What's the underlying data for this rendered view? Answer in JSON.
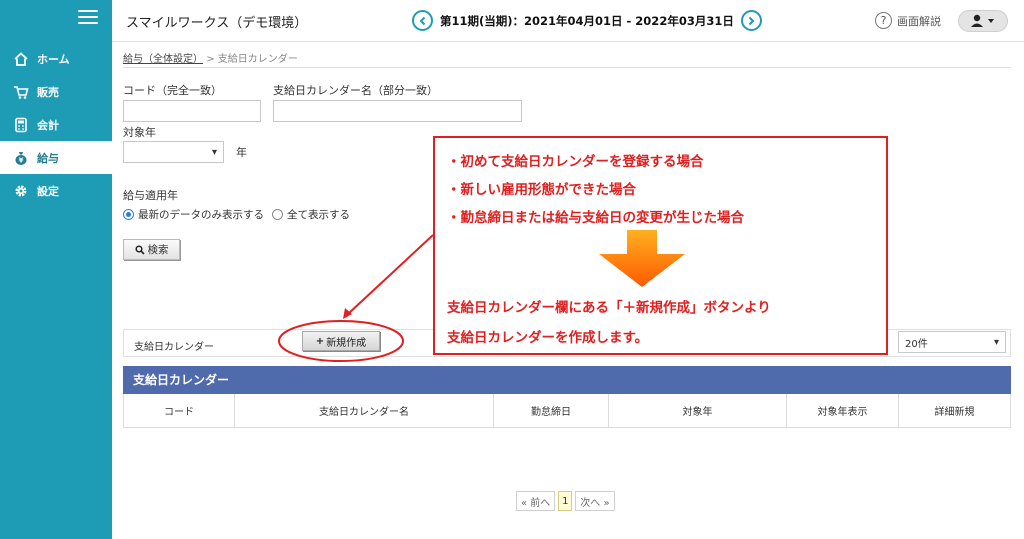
{
  "app": {
    "title": "スマイルワークス（デモ環境）",
    "period": "第11期(当期)：2021年04月01日 - 2022年03月31日",
    "help_label": "画面解説"
  },
  "sidebar": {
    "items": [
      {
        "label": "ホーム",
        "icon": "home-icon"
      },
      {
        "label": "販売",
        "icon": "cart-icon"
      },
      {
        "label": "会計",
        "icon": "calculator-icon"
      },
      {
        "label": "給与",
        "icon": "money-bag-icon",
        "active": true
      },
      {
        "label": "設定",
        "icon": "gear-icon"
      }
    ]
  },
  "breadcrumb": {
    "parent": "給与（全体設定）",
    "separator": ">",
    "current": "支給日カレンダー"
  },
  "search": {
    "code_label": "コード（完全一致）",
    "code_value": "",
    "name_label": "支給日カレンダー名（部分一致）",
    "name_value": "",
    "year_label": "対象年",
    "year_value": "",
    "year_suffix": "年",
    "apply_year_label": "給与適用年",
    "radio_latest": "最新のデータのみ表示する",
    "radio_all": "全て表示する",
    "search_button": "検索"
  },
  "toolbar": {
    "label": "支給日カレンダー",
    "new_button": "新規作成",
    "per_page": "20件"
  },
  "table": {
    "title": "支給日カレンダー",
    "columns": [
      "コード",
      "支給日カレンダー名",
      "勤怠締日",
      "対象年",
      "対象年表示",
      "詳細新規"
    ]
  },
  "pagination": {
    "prev": "« 前へ",
    "current": "1",
    "next": "次へ »"
  },
  "annotation": {
    "bullets": [
      "・初めて支給日カレンダーを登録する場合",
      "・新しい雇用形態ができた場合",
      "・勤怠締日または給与支給日の変更が生じた場合"
    ],
    "note_line1": "支給日カレンダー欄にある「＋新規作成」ボタンより",
    "note_line2": "支給日カレンダーを作成します。",
    "colors": {
      "red": "#e02020",
      "arrow_top": "#ffb020",
      "arrow_bottom": "#ff5a00"
    }
  }
}
